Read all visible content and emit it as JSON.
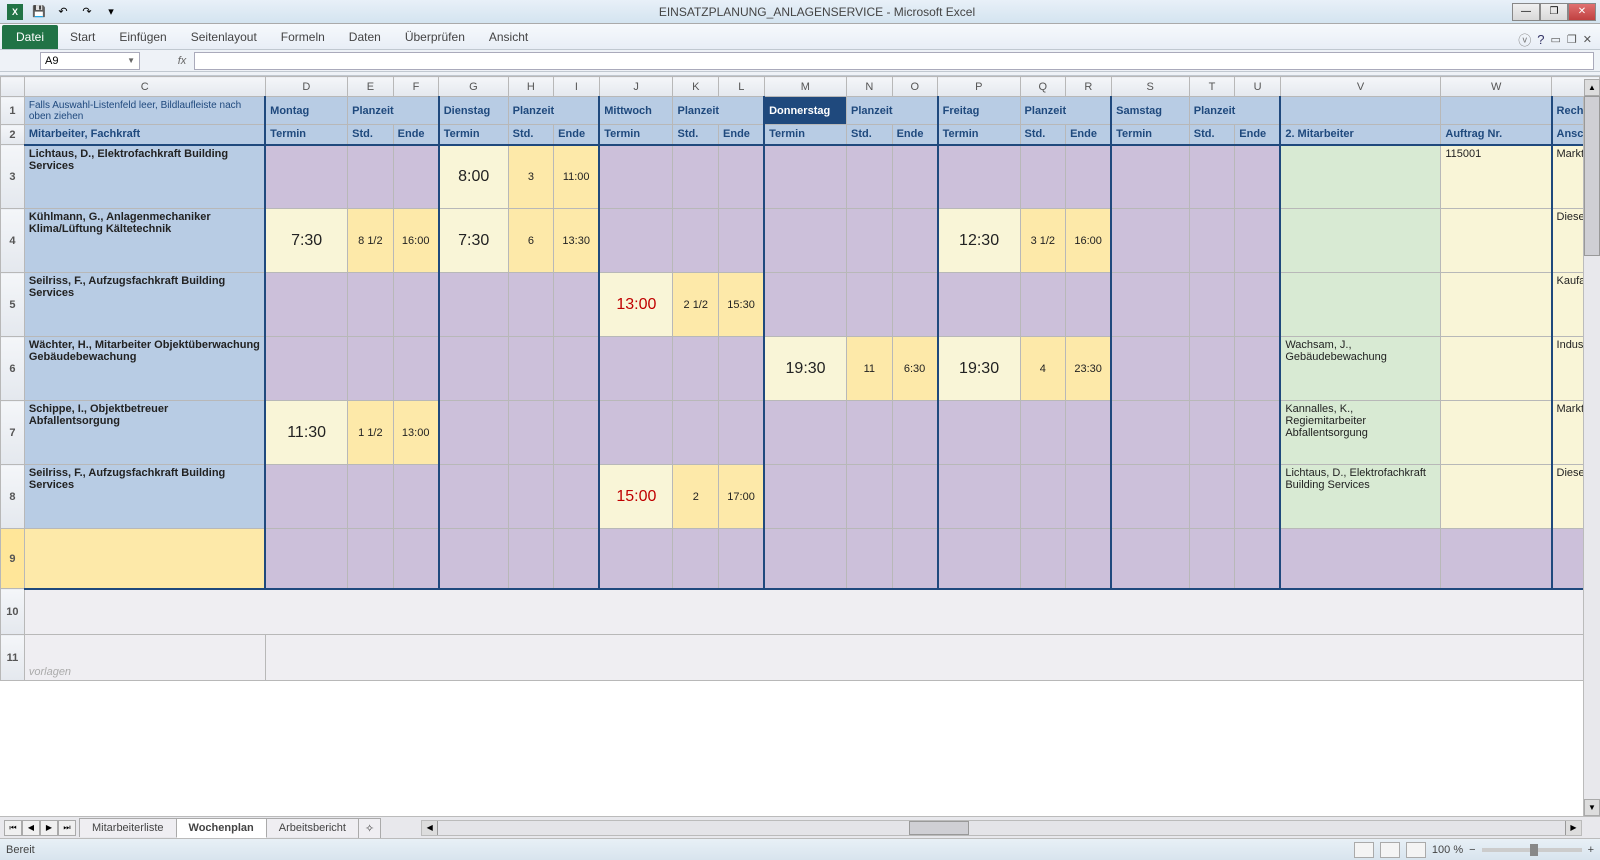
{
  "window": {
    "title": "EINSATZPLANUNG_ANLAGENSERVICE - Microsoft Excel",
    "qat_icon": "X"
  },
  "ribbon": {
    "file": "Datei",
    "tabs": [
      "Start",
      "Einfügen",
      "Seitenlayout",
      "Formeln",
      "Daten",
      "Überprüfen",
      "Ansicht"
    ]
  },
  "formula": {
    "name_box": "A9",
    "fx": "fx"
  },
  "columns": [
    "C",
    "D",
    "E",
    "F",
    "G",
    "H",
    "I",
    "J",
    "K",
    "L",
    "M",
    "N",
    "O",
    "P",
    "Q",
    "R",
    "S",
    "T",
    "U",
    "V",
    "W",
    ""
  ],
  "header1": {
    "note": "Falls Auswahl-Listenfeld leer, Bildlaufleiste nach oben ziehen",
    "days": [
      "Montag",
      "Dienstag",
      "Mittwoch",
      "Donnerstag",
      "Freitag",
      "Samstag"
    ],
    "planzeit": "Planzeit",
    "rech": "Rech"
  },
  "header2": {
    "mitarbeiter": "Mitarbeiter, Fachkraft",
    "termin": "Termin",
    "std": "Std.",
    "ende": "Ende",
    "mitarbeiter2": "2. Mitarbeiter",
    "auftrag": "Auftrag Nr.",
    "ansch": "Ansch"
  },
  "rows": [
    {
      "num": "3",
      "name": "Lichtaus, D., Elektrofachkraft Building Services",
      "mo": [
        "",
        "",
        ""
      ],
      "di": [
        "8:00",
        "3",
        "11:00"
      ],
      "mi": [
        "",
        "",
        ""
      ],
      "do": [
        "",
        "",
        ""
      ],
      "fr": [
        "",
        "",
        ""
      ],
      "sa": [
        "",
        "",
        ""
      ],
      "m2": "",
      "auftrag": "115001",
      "ansch": "Markt"
    },
    {
      "num": "4",
      "name": "Kühlmann, G., Anlagenmechaniker Klima/Lüftung Kältetechnik",
      "mo": [
        "7:30",
        "8 1/2",
        "16:00"
      ],
      "di": [
        "7:30",
        "6",
        "13:30"
      ],
      "mi": [
        "",
        "",
        ""
      ],
      "do": [
        "",
        "",
        ""
      ],
      "fr": [
        "12:30",
        "3 1/2",
        "16:00"
      ],
      "sa": [
        "",
        "",
        ""
      ],
      "m2": "",
      "auftrag": "",
      "ansch": "Diese"
    },
    {
      "num": "5",
      "name": "Seilriss, F., Aufzugsfachkraft Building Services",
      "mo": [
        "",
        "",
        ""
      ],
      "di": [
        "",
        "",
        ""
      ],
      "mi": [
        "13:00",
        "2 1/2",
        "15:30"
      ],
      "do": [
        "",
        "",
        ""
      ],
      "fr": [
        "",
        "",
        ""
      ],
      "sa": [
        "",
        "",
        ""
      ],
      "mi_red": true,
      "m2": "",
      "auftrag": "",
      "ansch": "Kaufa"
    },
    {
      "num": "6",
      "name": "Wächter, H., Mitarbeiter Objektüberwachung Gebäudebewachung",
      "mo": [
        "",
        "",
        ""
      ],
      "di": [
        "",
        "",
        ""
      ],
      "mi": [
        "",
        "",
        ""
      ],
      "do": [
        "19:30",
        "11",
        "6:30"
      ],
      "fr": [
        "19:30",
        "4",
        "23:30"
      ],
      "sa": [
        "",
        "",
        ""
      ],
      "m2": "Wachsam, J., Gebäudebewachung",
      "auftrag": "",
      "ansch": "Indust"
    },
    {
      "num": "7",
      "name": "Schippe, I., Objektbetreuer Abfallentsorgung",
      "mo": [
        "11:30",
        "1 1/2",
        "13:00"
      ],
      "di": [
        "",
        "",
        ""
      ],
      "mi": [
        "",
        "",
        ""
      ],
      "do": [
        "",
        "",
        ""
      ],
      "fr": [
        "",
        "",
        ""
      ],
      "sa": [
        "",
        "",
        ""
      ],
      "m2": "Kannalles, K., Regiemitarbeiter Abfallentsorgung",
      "auftrag": "",
      "ansch": "Markt"
    },
    {
      "num": "8",
      "name": "Seilriss, F., Aufzugsfachkraft Building Services",
      "mo": [
        "",
        "",
        ""
      ],
      "di": [
        "",
        "",
        ""
      ],
      "mi": [
        "15:00",
        "2",
        "17:00"
      ],
      "do": [
        "",
        "",
        ""
      ],
      "fr": [
        "",
        "",
        ""
      ],
      "sa": [
        "",
        "",
        ""
      ],
      "mi_red": true,
      "m2": "Lichtaus, D., Elektrofachkraft Building Services",
      "auftrag": "",
      "ansch": "Diese"
    }
  ],
  "empty_rows": [
    "9",
    "10",
    "11"
  ],
  "watermark": "vorlagen",
  "sheets": {
    "tabs": [
      "Mitarbeiterliste",
      "Wochenplan",
      "Arbeitsbericht"
    ],
    "active": 1
  },
  "status": {
    "ready": "Bereit",
    "zoom": "100 %"
  }
}
